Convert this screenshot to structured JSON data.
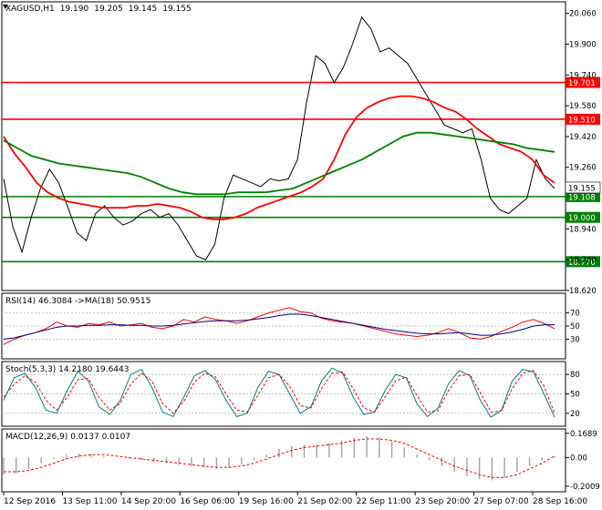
{
  "chart_data": {
    "type": "line",
    "instrument": "XAGUSD,H1",
    "ohlc": {
      "open": "19.190",
      "high": "19.205",
      "low": "19.145",
      "close": "19.155"
    },
    "price_axis": {
      "ylim": [
        18.62,
        20.12
      ],
      "ticks": [
        "20.060",
        "19.900",
        "19.740",
        "19.580",
        "19.420",
        "19.260",
        "18.940",
        "18.780",
        "18.620"
      ]
    },
    "levels": [
      {
        "value": 19.701,
        "label": "19.701",
        "color": "#ff0000"
      },
      {
        "value": 19.51,
        "label": "19.510",
        "color": "#ff0000"
      },
      {
        "value": 19.108,
        "label": "19.108",
        "color": "#008000"
      },
      {
        "value": 19.0,
        "label": "19.000",
        "color": "#008000"
      },
      {
        "value": 18.77,
        "label": "18.770",
        "color": "#008000"
      }
    ],
    "current_price": {
      "value": 19.155,
      "label": "19.155"
    },
    "series": [
      {
        "color": "#000000",
        "values": [
          19.2,
          18.95,
          18.82,
          19.0,
          19.15,
          19.25,
          19.18,
          19.05,
          18.92,
          18.88,
          19.02,
          19.06,
          19.0,
          18.96,
          18.98,
          19.02,
          19.04,
          19.0,
          19.02,
          18.96,
          18.88,
          18.8,
          18.78,
          18.86,
          19.1,
          19.22,
          19.2,
          19.18,
          19.16,
          19.2,
          19.19,
          19.2,
          19.3,
          19.6,
          19.84,
          19.8,
          19.7,
          19.78,
          19.9,
          20.04,
          19.98,
          19.86,
          19.88,
          19.84,
          19.8,
          19.72,
          19.64,
          19.56,
          19.48,
          19.46,
          19.44,
          19.46,
          19.3,
          19.1,
          19.04,
          19.02,
          19.06,
          19.1,
          19.3,
          19.2,
          19.15
        ]
      },
      {
        "color": "#ff0000",
        "values": [
          19.42,
          19.33,
          19.26,
          19.18,
          19.13,
          19.1,
          19.08,
          19.07,
          19.06,
          19.05,
          19.05,
          19.05,
          19.06,
          19.06,
          19.07,
          19.06,
          19.05,
          19.03,
          19.0,
          18.99,
          18.99,
          19.0,
          19.02,
          19.05,
          19.07,
          19.09,
          19.11,
          19.13,
          19.16,
          19.2,
          19.3,
          19.43,
          19.52,
          19.57,
          19.6,
          19.62,
          19.63,
          19.63,
          19.62,
          19.6,
          19.57,
          19.55,
          19.51,
          19.46,
          19.42,
          19.38,
          19.36,
          19.34,
          19.3,
          19.22,
          19.18
        ]
      },
      {
        "color": "#008000",
        "values": [
          19.4,
          19.36,
          19.32,
          19.3,
          19.28,
          19.27,
          19.26,
          19.25,
          19.24,
          19.23,
          19.21,
          19.18,
          19.15,
          19.13,
          19.12,
          19.12,
          19.12,
          19.13,
          19.13,
          19.13,
          19.14,
          19.15,
          19.18,
          19.21,
          19.24,
          19.27,
          19.3,
          19.34,
          19.38,
          19.42,
          19.44,
          19.44,
          19.43,
          19.42,
          19.41,
          19.4,
          19.39,
          19.38,
          19.36,
          19.35,
          19.34
        ]
      }
    ],
    "x_tick_labels": [
      "12 Sep 2016",
      "13 Sep 11:00",
      "14 Sep 20:00",
      "16 Sep 06:00",
      "19 Sep 16:00",
      "21 Sep 02:00",
      "22 Sep 11:00",
      "23 Sep 20:00",
      "27 Sep 07:00",
      "28 Sep 16:00"
    ],
    "panels": [
      {
        "name": "rsi",
        "label": "RSI(14) 46.3084  ->MA(18) 50.9515",
        "ylim": [
          0,
          100
        ],
        "ticks": [
          "70",
          "50",
          "30"
        ],
        "series": [
          {
            "color": "#ff0000",
            "values": [
              22,
              30,
              36,
              40,
              46,
              56,
              50,
              48,
              54,
              52,
              56,
              50,
              52,
              54,
              48,
              46,
              50,
              60,
              56,
              64,
              60,
              58,
              54,
              58,
              64,
              70,
              74,
              78,
              72,
              70,
              62,
              58,
              56,
              54,
              50,
              46,
              42,
              38,
              36,
              34,
              36,
              40,
              46,
              40,
              32,
              30,
              34,
              42,
              48,
              56,
              60,
              54,
              46
            ]
          },
          {
            "color": "#000080",
            "values": [
              30,
              32,
              36,
              40,
              44,
              48,
              50,
              50,
              51,
              51,
              52,
              52,
              51,
              51,
              50,
              50,
              51,
              53,
              55,
              57,
              58,
              58,
              58,
              59,
              61,
              63,
              66,
              68,
              68,
              66,
              63,
              60,
              57,
              54,
              51,
              48,
              45,
              43,
              41,
              39,
              38,
              38,
              39,
              40,
              38,
              36,
              36,
              38,
              41,
              45,
              50,
              52,
              52
            ]
          }
        ]
      },
      {
        "name": "stochastic",
        "label": "Stoch(5,3,3) 14.2180 19.6443",
        "ylim": [
          0,
          100
        ],
        "ticks": [
          "80",
          "50",
          "20"
        ],
        "series": [
          {
            "color": "#008080",
            "values": [
              40,
              75,
              82,
              60,
              25,
              20,
              55,
              85,
              70,
              30,
              18,
              40,
              80,
              88,
              60,
              22,
              15,
              45,
              78,
              86,
              72,
              40,
              15,
              20,
              60,
              85,
              80,
              50,
              20,
              30,
              70,
              90,
              82,
              45,
              18,
              22,
              55,
              80,
              75,
              35,
              15,
              28,
              66,
              86,
              78,
              40,
              14,
              25,
              70,
              88,
              84,
              50,
              14
            ]
          },
          {
            "color": "#ff0000",
            "values": [
              45,
              65,
              78,
              68,
              40,
              25,
              45,
              72,
              74,
              45,
              25,
              35,
              65,
              82,
              70,
              35,
              20,
              38,
              68,
              82,
              76,
              50,
              25,
              22,
              48,
              75,
              80,
              62,
              32,
              28,
              58,
              82,
              84,
              58,
              28,
              22,
              45,
              70,
              76,
              48,
              22,
              24,
              55,
              78,
              80,
              52,
              22,
              24,
              58,
              82,
              86,
              62,
              20
            ]
          }
        ]
      },
      {
        "name": "macd",
        "label": "MACD(12,26,9) 0.0137 0.0107",
        "ylim": [
          -0.24,
          0.2
        ],
        "ticks": [
          "0.1689",
          "0.00",
          "-0.2009"
        ],
        "histogram_color": "#a0a0a0",
        "signal_color": "#ff0000",
        "histogram": [
          -0.12,
          -0.11,
          -0.08,
          -0.04,
          -0.01,
          0.02,
          0.03,
          0.02,
          0.01,
          0.0,
          -0.01,
          -0.02,
          -0.03,
          -0.04,
          -0.05,
          -0.06,
          -0.07,
          -0.08,
          -0.07,
          -0.05,
          -0.02,
          0.02,
          0.06,
          0.08,
          0.09,
          0.09,
          0.1,
          0.12,
          0.14,
          0.15,
          0.14,
          0.11,
          0.07,
          0.02,
          -0.02,
          -0.06,
          -0.1,
          -0.13,
          -0.15,
          -0.16,
          -0.14,
          -0.1,
          -0.06,
          -0.02,
          0.01
        ],
        "signal": [
          -0.1,
          -0.1,
          -0.09,
          -0.07,
          -0.04,
          -0.01,
          0.01,
          0.02,
          0.02,
          0.01,
          0.0,
          -0.01,
          -0.02,
          -0.03,
          -0.04,
          -0.05,
          -0.06,
          -0.07,
          -0.07,
          -0.06,
          -0.04,
          -0.01,
          0.02,
          0.05,
          0.07,
          0.08,
          0.09,
          0.1,
          0.12,
          0.13,
          0.13,
          0.12,
          0.1,
          0.06,
          0.02,
          -0.02,
          -0.06,
          -0.09,
          -0.12,
          -0.14,
          -0.14,
          -0.12,
          -0.08,
          -0.04,
          0.01
        ]
      }
    ]
  }
}
